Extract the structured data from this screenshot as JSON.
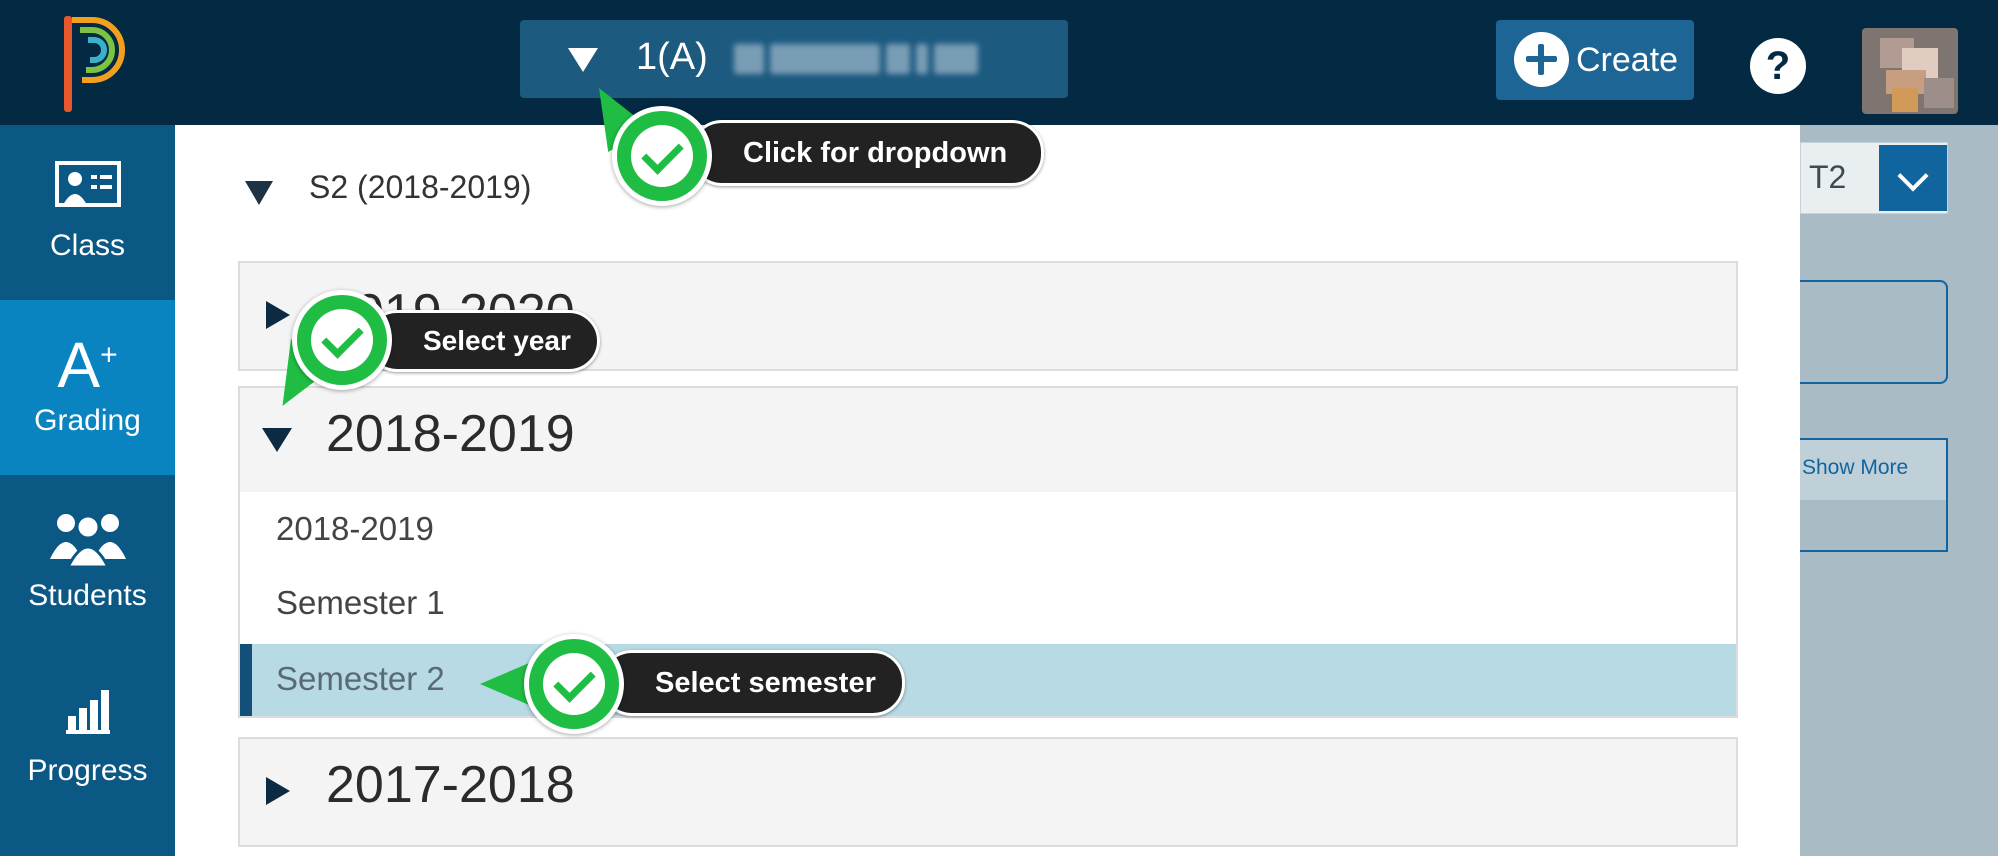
{
  "header": {
    "class_name": "1(A)",
    "create_label": "Create",
    "help_label": "?"
  },
  "nav": {
    "items": [
      {
        "label": "Class",
        "icon": "class-icon",
        "active": false
      },
      {
        "label": "Grading",
        "icon": "grading-icon",
        "active": true
      },
      {
        "label": "Students",
        "icon": "students-icon",
        "active": false
      },
      {
        "label": "Progress",
        "icon": "progress-icon",
        "active": false
      }
    ]
  },
  "dropdown": {
    "current_term": "S2 (2018-2019)",
    "years": [
      {
        "label": "2019-2020",
        "expanded": false
      },
      {
        "label": "2018-2019",
        "expanded": true,
        "terms": [
          {
            "label": "2018-2019",
            "selected": false
          },
          {
            "label": "Semester 1",
            "selected": false
          },
          {
            "label": "Semester 2",
            "selected": true
          }
        ]
      },
      {
        "label": "2017-2018",
        "expanded": false
      }
    ]
  },
  "background_panel": {
    "term_label": "T2",
    "show_more_label": "Show More"
  },
  "annotations": {
    "dropdown_hint": "Click for dropdown",
    "year_hint": "Select year",
    "semester_hint": "Select semester"
  },
  "colors": {
    "topbar": "#032a42",
    "nav": "#0c5885",
    "nav_active": "#0a84c1",
    "selected_row": "#b7dae5",
    "callout_green": "#1fbd43"
  }
}
